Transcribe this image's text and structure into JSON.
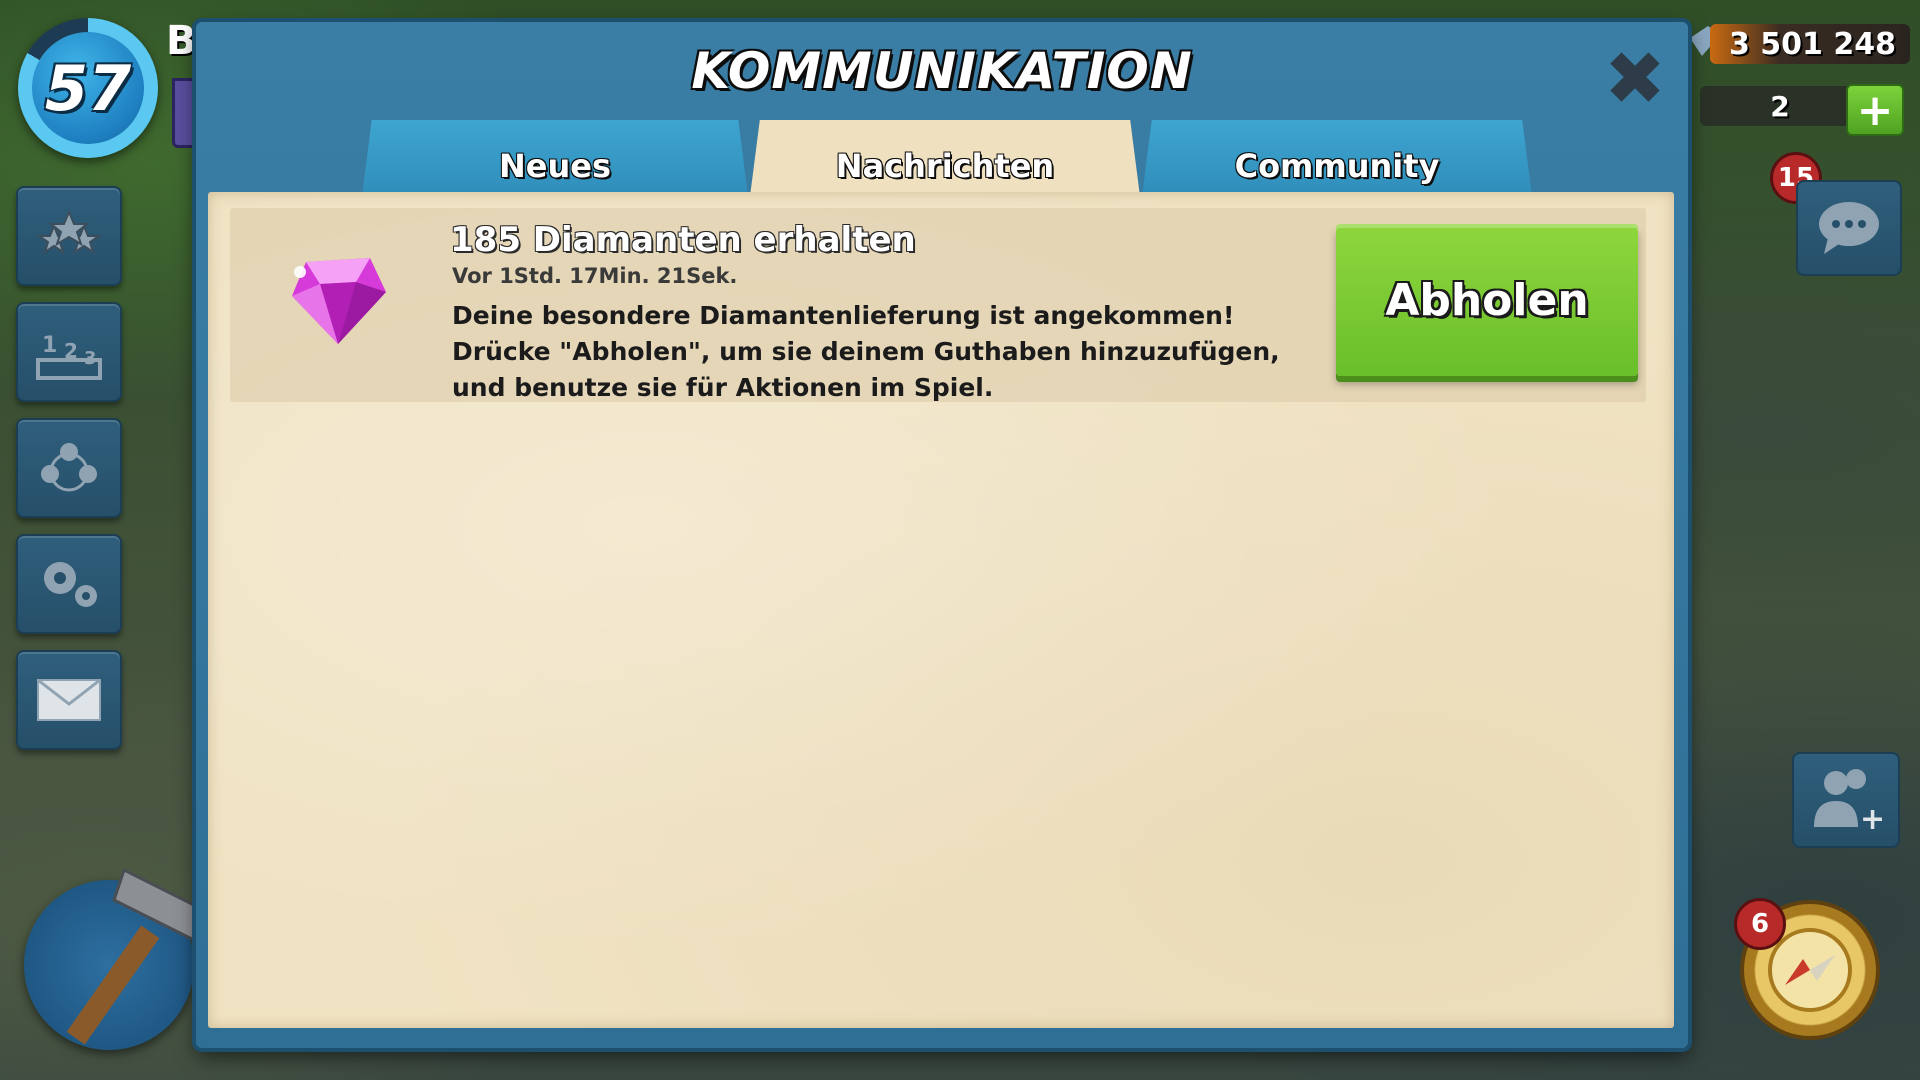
{
  "hud": {
    "level": "57",
    "player_name": "B",
    "gold": "3 501 248",
    "gems": "2",
    "gem_plus": "+",
    "chat_badge": "15",
    "compass_badge": "6"
  },
  "modal": {
    "title": "KOMMUNIKATION",
    "close": "✖",
    "tabs": [
      {
        "label": "Neues",
        "active": false
      },
      {
        "label": "Nachrichten",
        "active": true
      },
      {
        "label": "Community",
        "active": false
      }
    ]
  },
  "message": {
    "title": "185 Diamanten erhalten",
    "time": "Vor 1Std. 17Min. 21Sek.",
    "body_line1": "Deine besondere Diamantenlieferung ist angekommen!",
    "body_line2": "Drücke \"Abholen\", um sie deinem Guthaben hinzuzufügen,",
    "body_line3": "und benutze sie für Aktionen im Spiel.",
    "button_label": "Abholen",
    "icon": "gem-icon"
  },
  "side_menu": [
    "star-icon",
    "leaderboard-icon",
    "task-force-icon",
    "settings-icon",
    "mail-icon",
    "hammer-icon"
  ],
  "colors": {
    "modal_blue": "#2f6f96",
    "tab_blue": "#2d88b5",
    "paper": "#f0e3c3",
    "claim_green": "#69bf2a",
    "badge_red": "#b8292a"
  }
}
